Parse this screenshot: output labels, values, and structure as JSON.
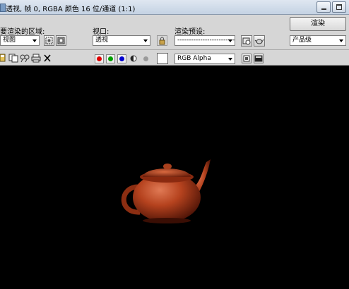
{
  "window": {
    "title": "透视, 帧 0, RGBA 颜色 16 位/通道 (1:1)",
    "icons": [
      "app-icon",
      "minimize-icon",
      "restore-icon"
    ]
  },
  "render_area": {
    "label": "要渲染的区域:",
    "value": "视图"
  },
  "viewport": {
    "label": "视口:",
    "value": "透视"
  },
  "preset": {
    "label": "渲染预设:",
    "value": "--------------------------"
  },
  "render": {
    "button_label": "渲染",
    "mode_value": "产品级"
  },
  "channel": {
    "value": "RGB Alpha",
    "colors": {
      "red": "#e00000",
      "green": "#00a000",
      "blue": "#0000d0",
      "disabled": "#9a9a9a",
      "teapot": "#b5421e"
    }
  }
}
